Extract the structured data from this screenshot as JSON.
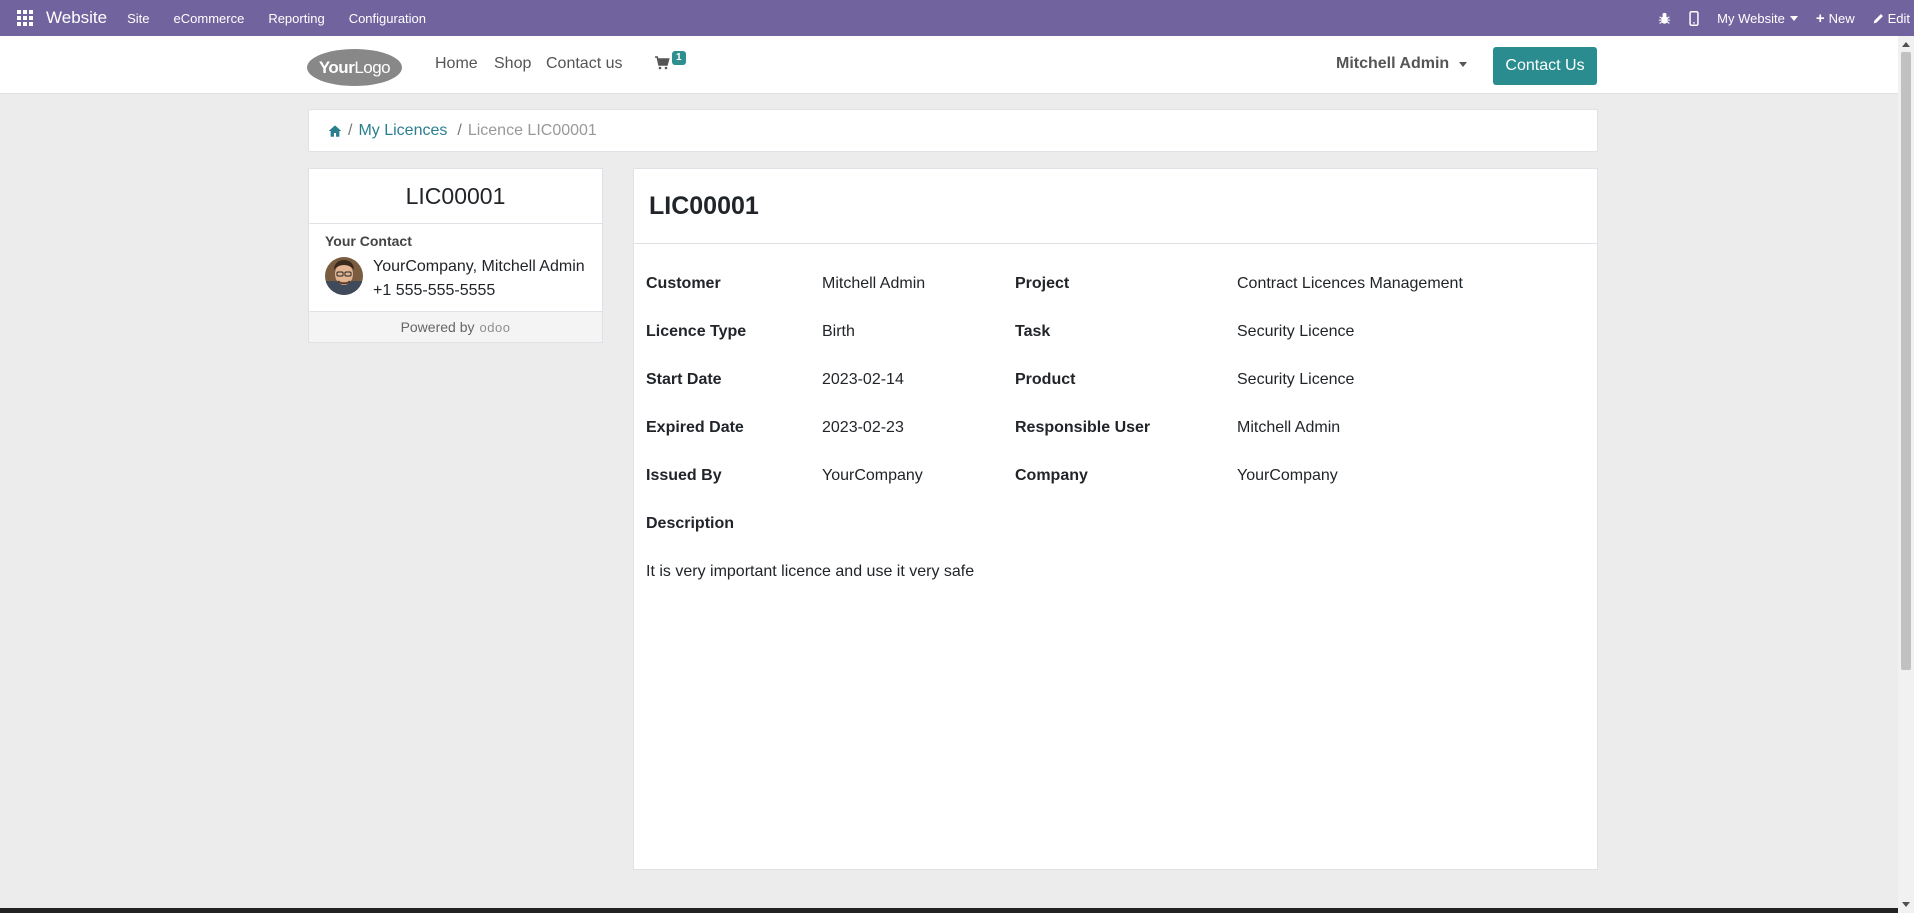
{
  "adminbar": {
    "brand": "Website",
    "menu": [
      "Site",
      "eCommerce",
      "Reporting",
      "Configuration"
    ],
    "website_selector": "My Website",
    "new_label": "New",
    "edit_label": "Edit"
  },
  "header": {
    "logo_text_bold": "Your",
    "logo_text_light": "Logo",
    "nav": [
      "Home",
      "Shop",
      "Contact us"
    ],
    "cart_count": "1",
    "user_name": "Mitchell Admin",
    "contact_button": "Contact Us"
  },
  "breadcrumb": {
    "sep1": "/",
    "link": "My Licences",
    "sep2": "/",
    "current": "Licence LIC00001"
  },
  "sidebar": {
    "title": "LIC00001",
    "contact_label": "Your Contact",
    "contact_name": "YourCompany, Mitchell Admin",
    "contact_phone": "+1 555-555-5555",
    "powered_by": "Powered by",
    "powered_brand": "odoo"
  },
  "record": {
    "title": "LIC00001",
    "fields": {
      "customer": {
        "label": "Customer",
        "value": "Mitchell Admin"
      },
      "licence_type": {
        "label": "Licence Type",
        "value": "Birth"
      },
      "start_date": {
        "label": "Start Date",
        "value": "2023-02-14"
      },
      "expired_date": {
        "label": "Expired Date",
        "value": "2023-02-23"
      },
      "issued_by": {
        "label": "Issued By",
        "value": "YourCompany"
      },
      "project": {
        "label": "Project",
        "value": "Contract Licences Management"
      },
      "task": {
        "label": "Task",
        "value": "Security Licence"
      },
      "product": {
        "label": "Product",
        "value": "Security Licence"
      },
      "responsible_user": {
        "label": "Responsible User",
        "value": "Mitchell Admin"
      },
      "company": {
        "label": "Company",
        "value": "YourCompany"
      }
    },
    "description_label": "Description",
    "description": "It is very important licence and use it very safe"
  },
  "colors": {
    "adminbar": "#71639e",
    "accent": "#2a8c8e",
    "link": "#2a7f8f"
  }
}
